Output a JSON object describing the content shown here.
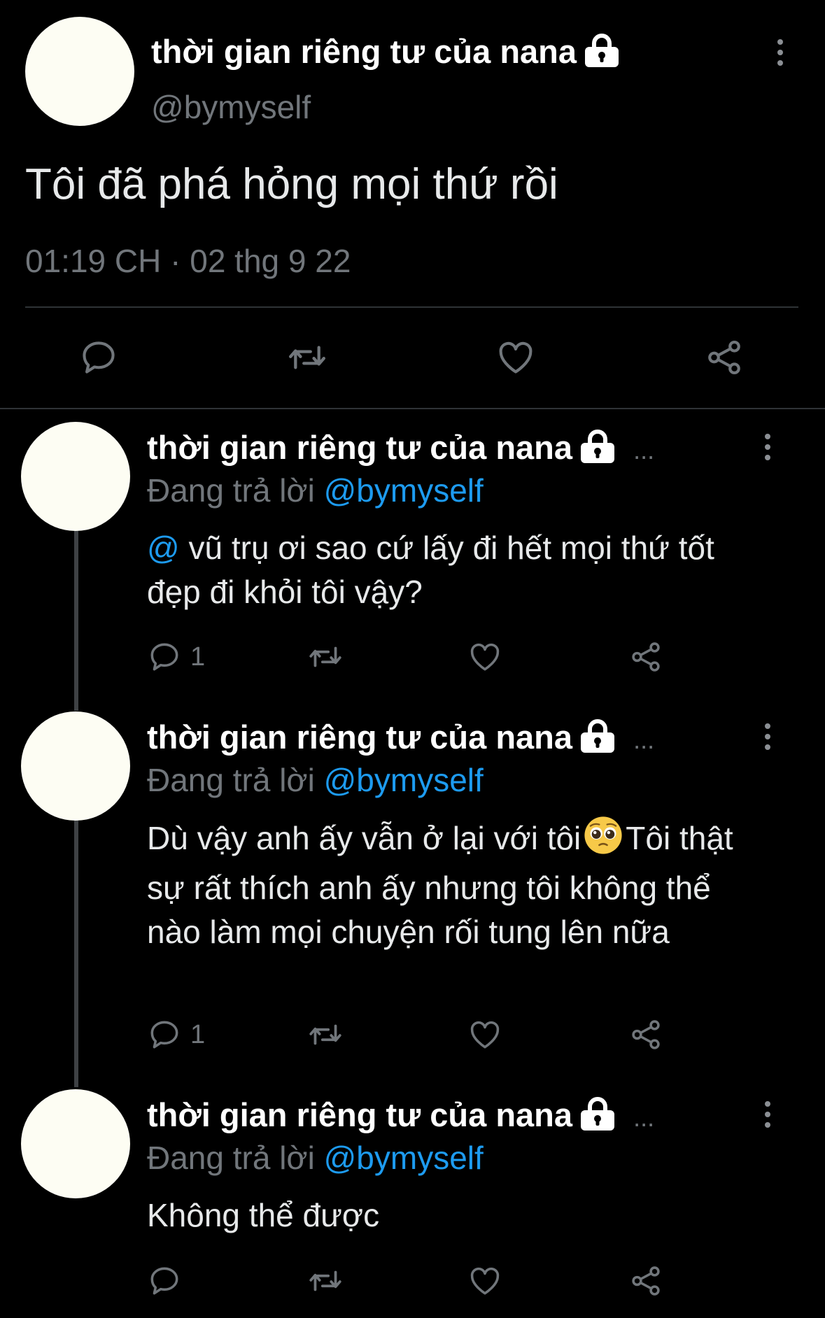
{
  "main_tweet": {
    "author_name": "thời gian riêng tư của nana",
    "handle": "@bymyself",
    "text": "Tôi đã phá hỏng mọi thứ rồi",
    "time": "01:19 CH",
    "separator": "·",
    "date": "02 thg 9 22"
  },
  "replies": [
    {
      "author_name": "thời gian riêng tư của nana",
      "ellipsis": "...",
      "replying_prefix": "Đang trả lời",
      "replying_handle": "@bymyself",
      "mention": "@",
      "text": "vũ trụ ơi sao cứ lấy đi hết mọi thứ tốt đẹp đi khỏi tôi vậy?",
      "reply_count": "1"
    },
    {
      "author_name": "thời gian riêng tư của nana",
      "ellipsis": "...",
      "replying_prefix": "Đang trả lời",
      "replying_handle": "@bymyself",
      "text_before_emoji": "Dù vậy anh ấy vẫn ở lại với tôi",
      "text_after_emoji": "Tôi thật sự rất thích anh ấy nhưng tôi không thể nào làm mọi chuyện rối tung lên nữa",
      "emoji": "pleading-face-emoji",
      "reply_count": "1"
    },
    {
      "author_name": "thời gian riêng tư của nana",
      "ellipsis": "...",
      "replying_prefix": "Đang trả lời",
      "replying_handle": "@bymyself",
      "text": "Không thể được",
      "reply_count": ""
    }
  ],
  "icons": {
    "lock": "lock-icon",
    "more": "more-vertical-icon",
    "reply": "reply-icon",
    "retweet": "retweet-icon",
    "like": "heart-icon",
    "share": "share-icon"
  },
  "colors": {
    "background": "#000000",
    "text": "#e7e9ea",
    "muted": "#71767b",
    "link": "#1d9bf0",
    "avatar": "#fdfdf3"
  }
}
